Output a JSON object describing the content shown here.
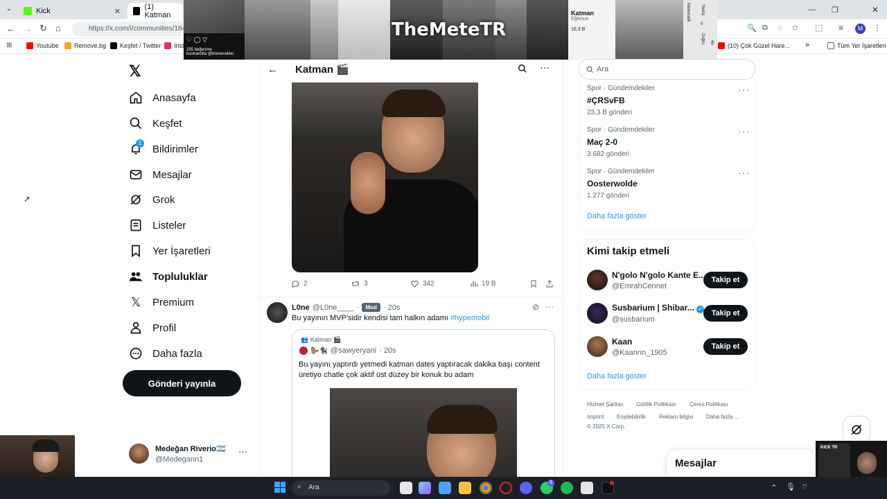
{
  "browser": {
    "tabs": [
      {
        "label": "Kick",
        "color": "#53fc18"
      },
      {
        "label": "(1) Katman",
        "color": "#000000"
      }
    ],
    "url": "https://x.com/i/communities/184",
    "bookmarks": [
      {
        "label": "Youtube",
        "color": "#ff0000"
      },
      {
        "label": "Remove.bg",
        "color": "#f5a623"
      },
      {
        "label": "Keşfet / Twitter",
        "color": "#000000"
      },
      {
        "label": "Inst",
        "color": "#e1306c"
      },
      {
        "label": "(10) Çok Güzel Hare...",
        "color": "#ff0000"
      },
      {
        "label": "Tüm Yer İşaretleri",
        "color": "#5f6368"
      }
    ],
    "profile_letter": "M"
  },
  "banner": {
    "title": "TheMeteTR",
    "likes": "255 beğenme",
    "caption": "kontravolta @brenecekler",
    "mini_title": "Katman",
    "mini_sub": "Eğlence",
    "mini_count": "16,3 B",
    "side_labels": [
      "Yanlış",
      "Matematik",
      "Doğru"
    ],
    "side_values": [
      "0",
      "40"
    ]
  },
  "nav": {
    "items": [
      {
        "label": "Anasayfa",
        "icon": "home-icon"
      },
      {
        "label": "Keşfet",
        "icon": "search-icon"
      },
      {
        "label": "Bildirimler",
        "icon": "bell-icon",
        "badge": "1"
      },
      {
        "label": "Mesajlar",
        "icon": "mail-icon"
      },
      {
        "label": "Grok",
        "icon": "grok-icon"
      },
      {
        "label": "Listeler",
        "icon": "list-icon"
      },
      {
        "label": "Yer İşaretleri",
        "icon": "bookmark-icon"
      },
      {
        "label": "Topluluklar",
        "icon": "communities-icon"
      },
      {
        "label": "Premium",
        "icon": "x-icon"
      },
      {
        "label": "Profil",
        "icon": "person-icon"
      },
      {
        "label": "Daha fazla",
        "icon": "more-circle-icon"
      }
    ],
    "post_button": "Gönderi yayınla",
    "account": {
      "name": "Medeğan Riverio🇦🇷",
      "handle": "@Medegann1"
    }
  },
  "header": {
    "title": "Katman 🎬"
  },
  "post1": {
    "replies": "2",
    "reposts": "3",
    "likes": "342",
    "views": "19 B"
  },
  "post2": {
    "name": "L0ne",
    "handle": "@L0ne____",
    "badge": "Mod",
    "time": "· 20s",
    "text": "Bu yayının MVP'sidir kendisi tam halkın adamı",
    "hashtag": "#hypemobil",
    "quote": {
      "community": "Katman 🎬",
      "handle": "@sawyeryani",
      "time": "· 20s",
      "text": "Bu yayını yaptırdı yetmedi katman dates yaptıracak dakika başı content üretiyo chatle çok aktif üst düzey bir konuk bu adam"
    }
  },
  "search": {
    "placeholder": "Ara"
  },
  "trends": [
    {
      "category": "Spor · Gündemdekiler",
      "name": "#ÇRSvFB",
      "count": "23,3 B gönderi"
    },
    {
      "category": "Spor · Gündemdekiler",
      "name": "Maç 2-0",
      "count": "3.682 gönderi"
    },
    {
      "category": "Spor · Gündemdekiler",
      "name": "Oosterwolde",
      "count": "1.277 gönderi"
    }
  ],
  "show_more": "Daha fazla göster",
  "who_to_follow": {
    "title": "Kimi takip etmeli",
    "button": "Takip et",
    "users": [
      {
        "name": "N'golo N'golo Kante E...",
        "handle": "@EmrahCennet"
      },
      {
        "name": "Susbarium | Shibar...",
        "handle": "@susbarium",
        "verified": true
      },
      {
        "name": "Kaan",
        "handle": "@Kaannn_1905"
      }
    ]
  },
  "footer_links": [
    "Hizmet Şartları",
    "Gizlilik Politikası",
    "Çerez Politikası",
    "Imprint",
    "Erişilebilirlik",
    "Reklam bilgisi",
    "Daha fazla ...",
    "© 2025 X Corp."
  ],
  "messages_drawer": {
    "title": "Mesajlar"
  },
  "taskbar": {
    "search": "Ara",
    "discord_badge": "3"
  },
  "stream_overlay": {
    "label": "KICK TR"
  }
}
